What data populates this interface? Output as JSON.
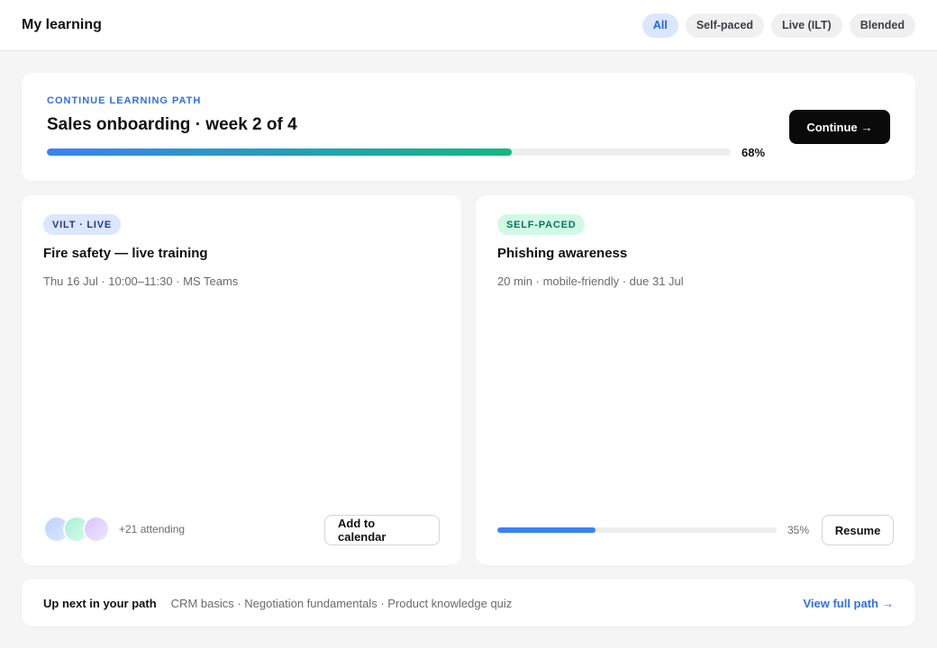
{
  "header": {
    "title": "My learning",
    "filters": [
      {
        "label": "All",
        "active": true
      },
      {
        "label": "Self-paced",
        "active": false
      },
      {
        "label": "Live (ILT)",
        "active": false
      },
      {
        "label": "Blended",
        "active": false
      }
    ]
  },
  "hero": {
    "eyebrow": "CONTINUE LEARNING PATH",
    "title": "Sales onboarding · week 2 of 4",
    "progress": 68,
    "progress_label": "68%",
    "button_label": "Continue",
    "button_icon": "arrow-right-icon"
  },
  "courses": [
    {
      "badge": "VILT · LIVE",
      "title": "Fire safety — live training",
      "meta": "Thu 16 Jul · 10:00–11:30 · MS Teams",
      "attending_label": "+21 attending",
      "button_label": "Add to calendar"
    },
    {
      "badge": "SELF-PACED",
      "title": "Phishing awareness",
      "meta": "20 min · mobile-friendly · due 31 Jul",
      "progress": 35,
      "progress_label": "35%",
      "button_label": "Resume"
    }
  ],
  "upnext": {
    "label": "Up next in your path",
    "items": "CRM basics · Negotiation fundamentals · Product knowledge quiz",
    "link_label": "View full path",
    "link_icon": "arrow-right-icon"
  },
  "colors": {
    "accent": "#2f6fed",
    "progress_start": "#3b82f6",
    "progress_end": "#10b981",
    "primary_button": "#0a0a0a"
  }
}
